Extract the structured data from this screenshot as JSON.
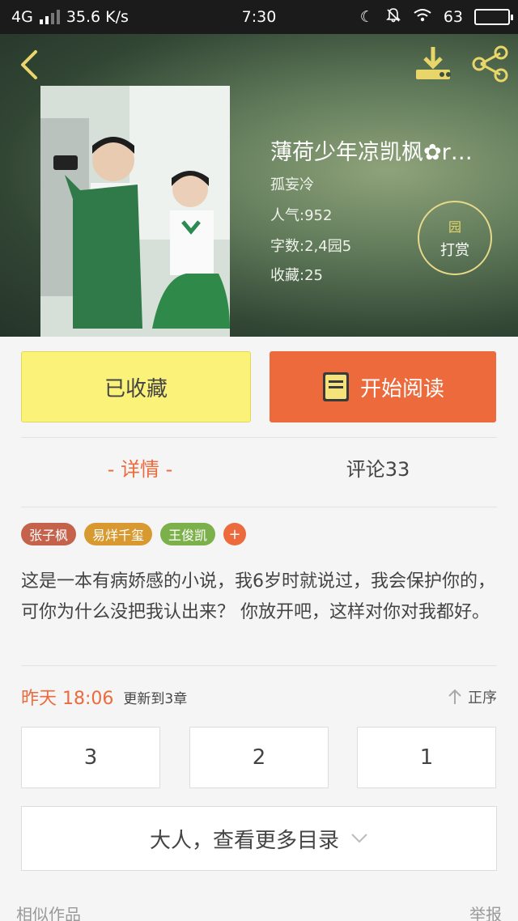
{
  "status_bar": {
    "network": "4G",
    "speed": "35.6 K/s",
    "time": "7:30",
    "battery_label": "63"
  },
  "header": {
    "title": "薄荷少年凉凯枫✿r…",
    "author": "孤妄冷",
    "popularity": "人气:952",
    "word_count": "字数:2,4园5",
    "favorites": "收藏:25",
    "reward_icon": "园",
    "reward_label": "打赏"
  },
  "actions": {
    "collected_label": "已收藏",
    "read_label": "开始阅读"
  },
  "tabs": {
    "detail": "- 详情 -",
    "comment": "评论33"
  },
  "tags": [
    {
      "label": "张子枫",
      "color": "#c5624c"
    },
    {
      "label": "易烊千玺",
      "color": "#d89a30"
    },
    {
      "label": "王俊凯",
      "color": "#7cb04a"
    }
  ],
  "tag_add": "+",
  "description": "这是一本有病娇感的小说，我6岁时就说过，我会保护你的，可你为什么没把我认出来？ 你放开吧，这样对你对我都好。",
  "update": {
    "time": "昨天 18:06",
    "count": "更新到3章",
    "sort_label": "正序"
  },
  "chapters": [
    "3",
    "2",
    "1"
  ],
  "more_label": "大人，查看更多目录",
  "footer": {
    "similar": "相似作品",
    "report": "举报"
  },
  "colors": {
    "accent": "#ec6a3c",
    "collected_bg": "#fbf27a",
    "reward_border": "#e8d98a"
  }
}
